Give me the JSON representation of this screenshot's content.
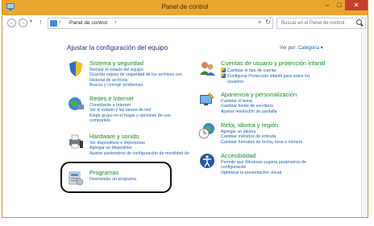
{
  "window": {
    "title": "Panel de control",
    "controls": {
      "minimize": "–",
      "maximize": "□",
      "close": "×"
    }
  },
  "address_bar": {
    "separator": "›",
    "breadcrumb": "Panel de control",
    "search_placeholder": "Buscar en el Panel de control"
  },
  "main": {
    "heading": "Ajustar la configuración del equipo",
    "view_by_label": "Ver por:",
    "view_by_value": "Categoría",
    "categories_left": [
      {
        "title": "Sistema y seguridad",
        "icon": "shield-icon",
        "links": [
          "Revisar el estado del equipo",
          "Guardar copias de seguridad de los archivos con",
          "Historial de archivos",
          "Buscar y corregir problemas"
        ]
      },
      {
        "title": "Redes e Internet",
        "icon": "globe-network-icon",
        "links": [
          "Conectarse a Internet",
          "Ver el estado y las tareas de red",
          "Elegir grupo en el hogar y opciones de uso",
          "compartido"
        ]
      },
      {
        "title": "Hardware y sonido",
        "icon": "printer-speaker-icon",
        "links": [
          "Ver dispositivos e impresoras",
          "Agregar un dispositivo",
          "Ajustar parámetros de configuración de movilidad de"
        ]
      },
      {
        "title": "Programas",
        "icon": "programs-icon",
        "links": [
          "Desinstalar un programa"
        ]
      }
    ],
    "categories_right": [
      {
        "title": "Cuentas de usuario y protección infantil",
        "icon": "users-icon",
        "links": [
          "Cambiar el tipo de cuenta",
          "Configurar Protección infantil para todos los",
          "usuarios"
        ]
      },
      {
        "title": "Apariencia y personalización",
        "icon": "monitor-brush-icon",
        "links": [
          "Cambiar el tema",
          "Cambiar fondo de escritorio",
          "Ajustar resolución de pantalla"
        ]
      },
      {
        "title": "Reloj, idioma y región",
        "icon": "clock-globe-icon",
        "links": [
          "Agregar un idioma",
          "Cambiar métodos de entrada",
          "Cambiar formatos de fecha, hora o número"
        ]
      },
      {
        "title": "Accesibilidad",
        "icon": "accessibility-icon",
        "links": [
          "Permitir que Windows sugiera parámetros de",
          "configuración",
          "Optimizar la presentación visual"
        ]
      }
    ]
  },
  "colors": {
    "titlebar": "#e8a631",
    "category_title": "#1a8a2a",
    "link": "#1e5fb3",
    "heading": "#1e3287",
    "close_button": "#c7402c"
  }
}
